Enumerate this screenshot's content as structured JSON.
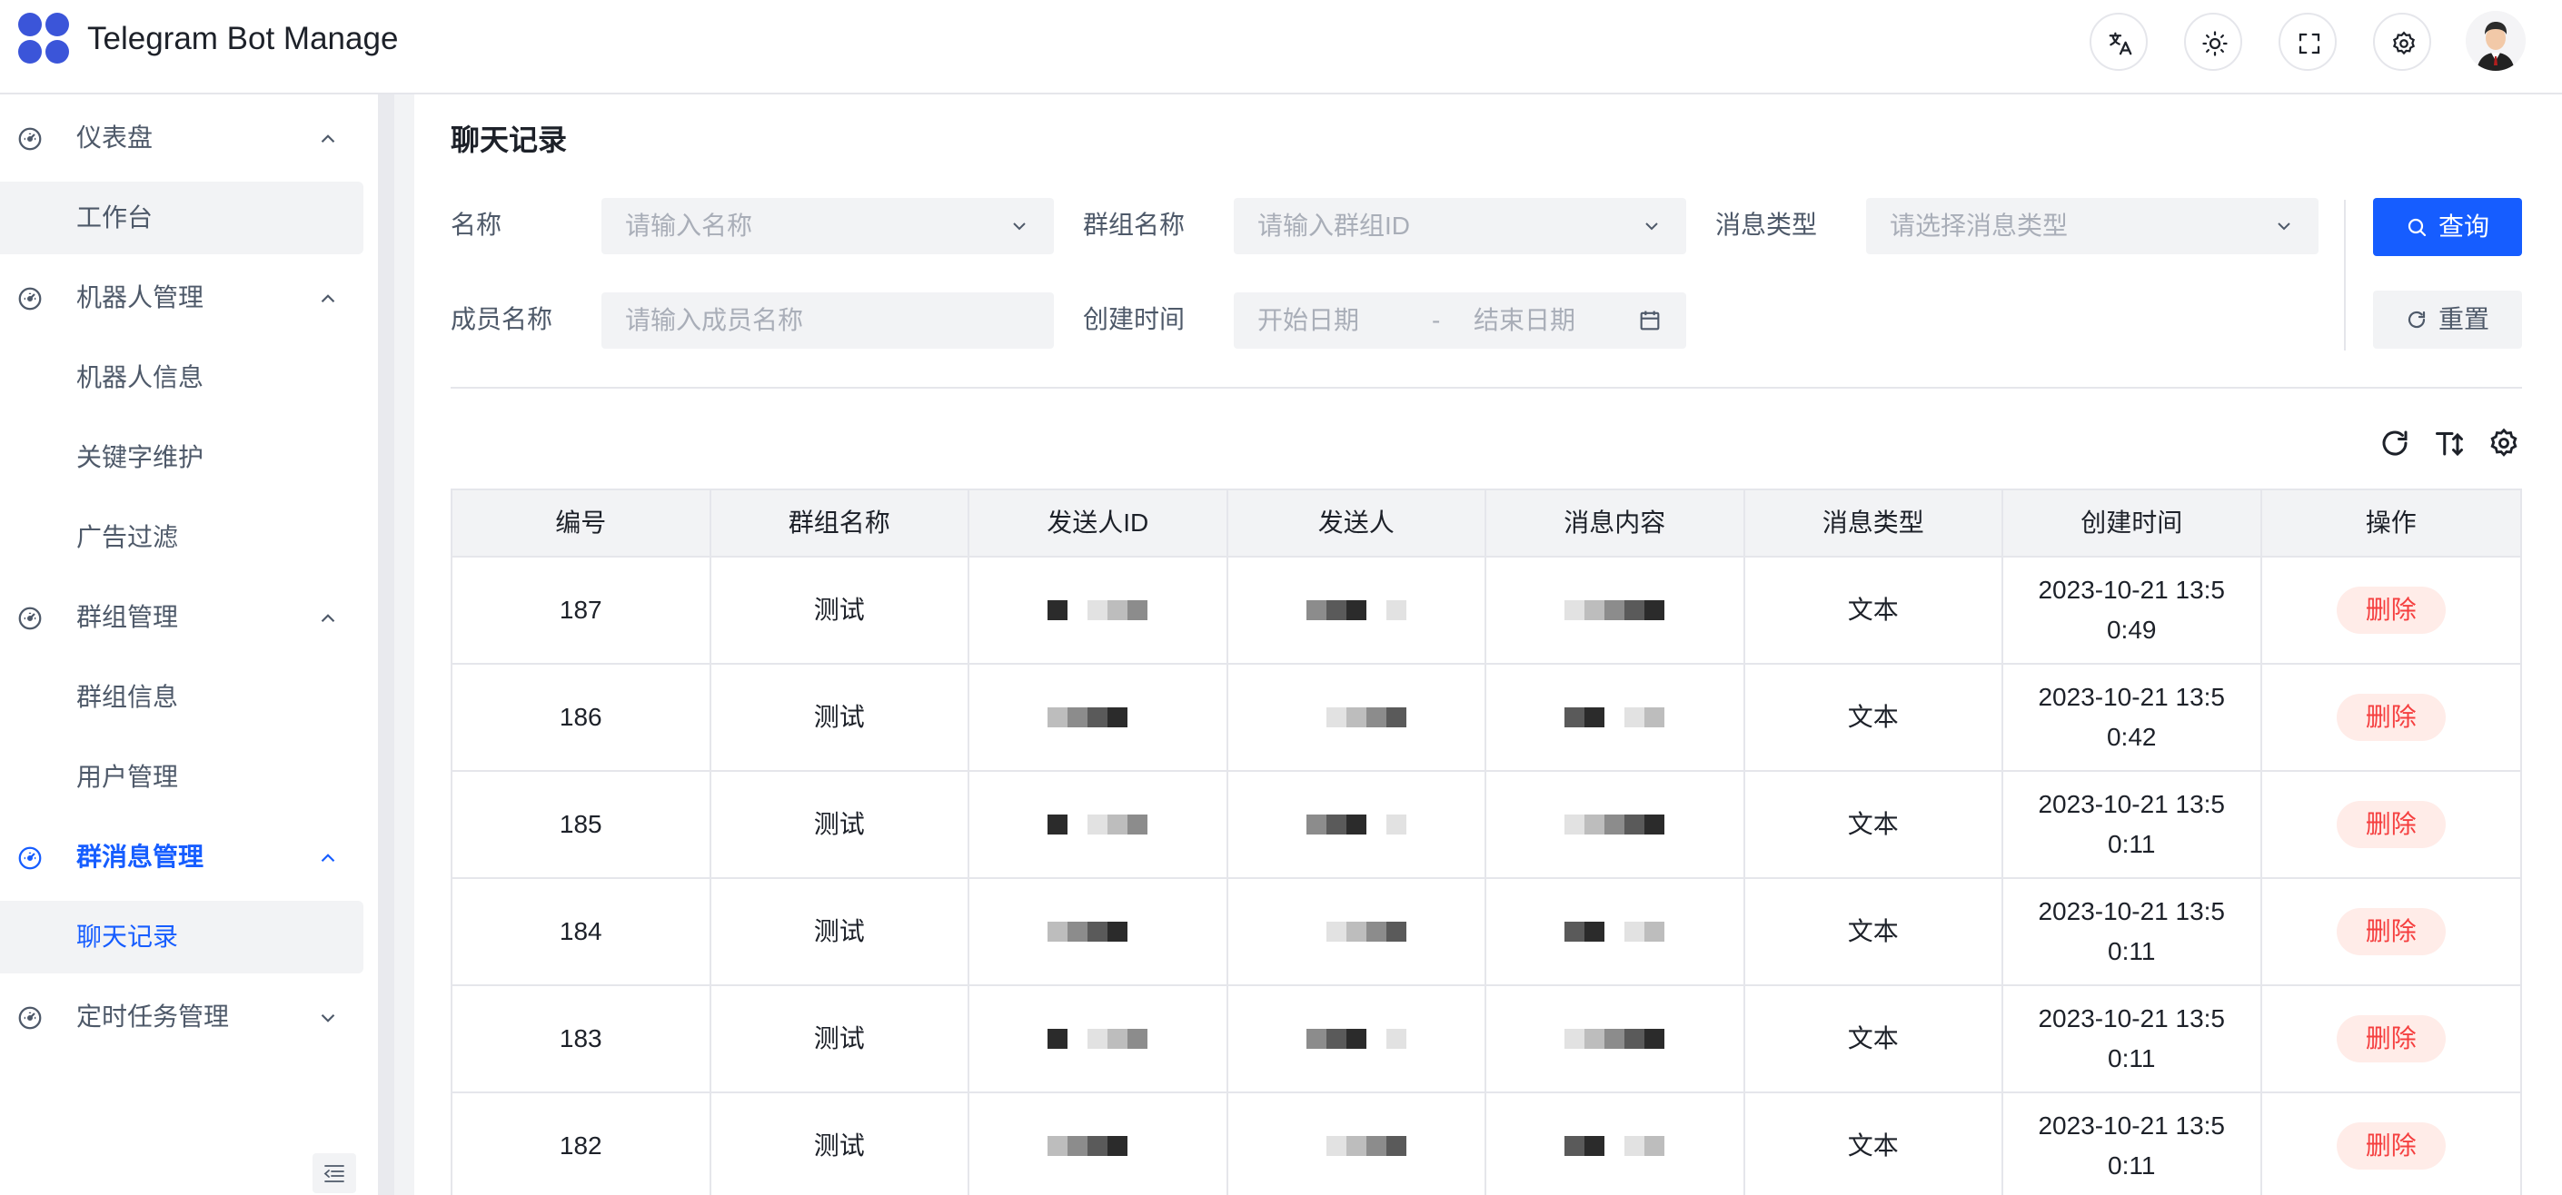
{
  "app": {
    "title": "Telegram Bot Manage"
  },
  "sidebar": {
    "groups": [
      {
        "label": "仪表盘",
        "items": [
          {
            "label": "工作台"
          }
        ]
      },
      {
        "label": "机器人管理",
        "items": [
          {
            "label": "机器人信息"
          },
          {
            "label": "关键字维护"
          },
          {
            "label": "广告过滤"
          }
        ]
      },
      {
        "label": "群组管理",
        "items": [
          {
            "label": "群组信息"
          },
          {
            "label": "用户管理"
          }
        ]
      },
      {
        "label": "群消息管理",
        "items": [
          {
            "label": "聊天记录"
          }
        ]
      },
      {
        "label": "定时任务管理",
        "items": []
      }
    ]
  },
  "page": {
    "title": "聊天记录"
  },
  "filters": {
    "name_label": "名称",
    "name_placeholder": "请输入名称",
    "group_label": "群组名称",
    "group_placeholder": "请输入群组ID",
    "type_label": "消息类型",
    "type_placeholder": "请选择消息类型",
    "member_label": "成员名称",
    "member_placeholder": "请输入成员名称",
    "created_label": "创建时间",
    "start_placeholder": "开始日期",
    "range_sep": "-",
    "end_placeholder": "结束日期",
    "query_label": "查询",
    "reset_label": "重置"
  },
  "table": {
    "columns": [
      "编号",
      "群组名称",
      "发送人ID",
      "发送人",
      "消息内容",
      "消息类型",
      "创建时间",
      "操作"
    ],
    "rows": [
      {
        "id": "187",
        "group": "测试",
        "type": "文本",
        "time": "2023-10-21 13:5\n0:49",
        "action": "删除"
      },
      {
        "id": "186",
        "group": "测试",
        "type": "文本",
        "time": "2023-10-21 13:5\n0:42",
        "action": "删除"
      },
      {
        "id": "185",
        "group": "测试",
        "type": "文本",
        "time": "2023-10-21 13:5\n0:11",
        "action": "删除"
      },
      {
        "id": "184",
        "group": "测试",
        "type": "文本",
        "time": "2023-10-21 13:5\n0:11",
        "action": "删除"
      },
      {
        "id": "183",
        "group": "测试",
        "type": "文本",
        "time": "2023-10-21 13:5\n0:11",
        "action": "删除"
      },
      {
        "id": "182",
        "group": "测试",
        "type": "文本",
        "time": "2023-10-21 13:5\n0:11",
        "action": "删除"
      }
    ]
  },
  "colors": {
    "primary": "#165dff",
    "danger": "#f53f3f",
    "danger_bg": "#ffece8"
  }
}
